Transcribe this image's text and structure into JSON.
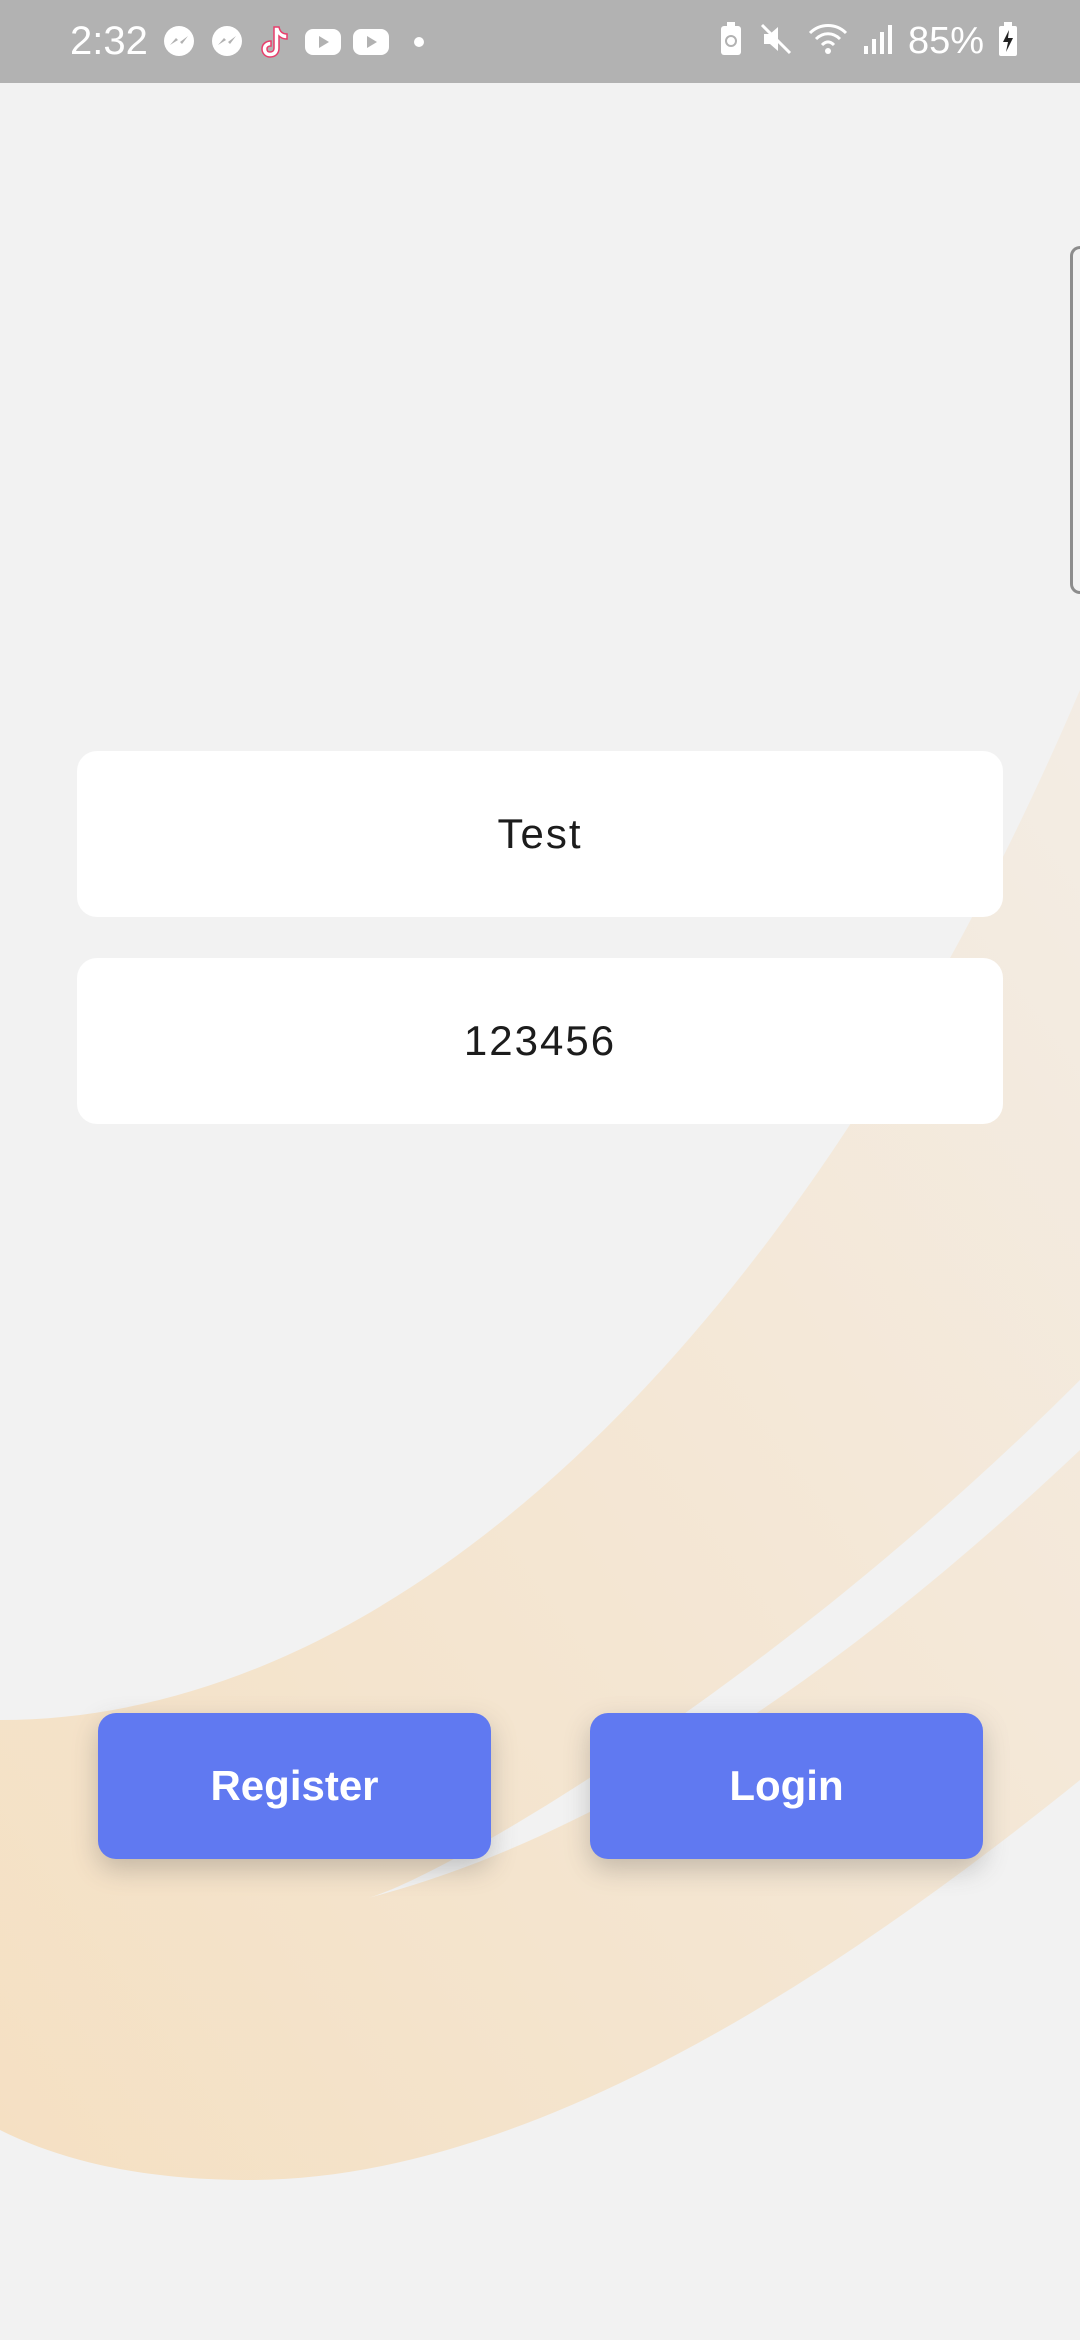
{
  "status_bar": {
    "time": "2:32",
    "notification_icons": [
      "messenger-icon",
      "messenger-icon",
      "tiktok-icon",
      "youtube-icon",
      "youtube-icon",
      "dot-icon"
    ],
    "system_icons": [
      "battery-saver-icon",
      "mute-icon",
      "wifi-icon",
      "signal-icon"
    ],
    "battery_percent": "85%"
  },
  "form": {
    "username_value": "Test",
    "password_value": "123456"
  },
  "buttons": {
    "register_label": "Register",
    "login_label": "Login"
  },
  "colors": {
    "status_bar": "#b2b2b2",
    "background": "#f2f2f2",
    "button": "#6079f1",
    "swoosh": "#f5dfc0"
  }
}
